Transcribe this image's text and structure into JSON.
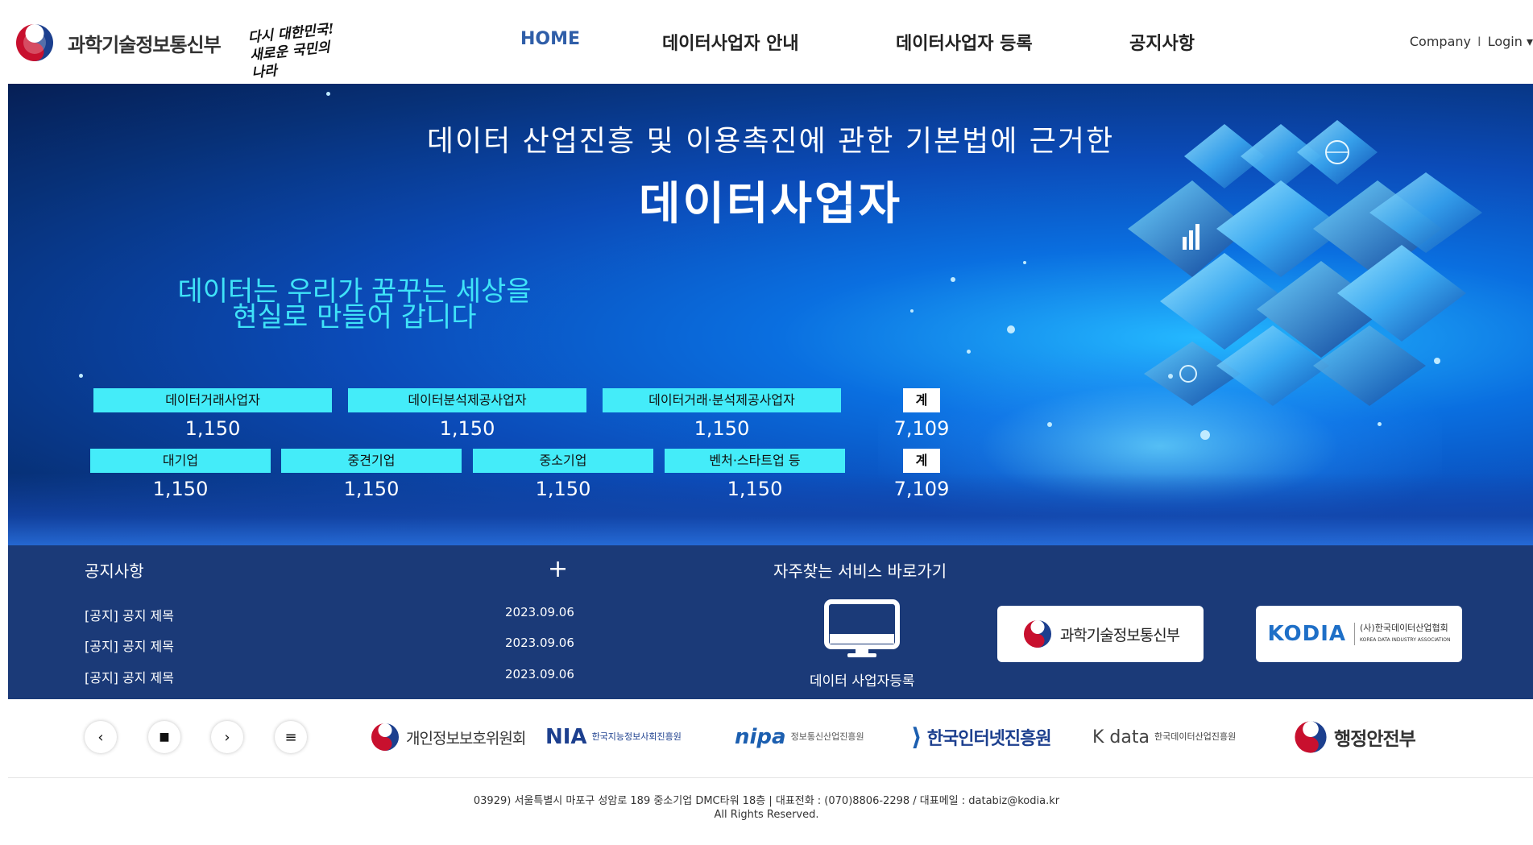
{
  "header": {
    "ministry_name": "과학기술정보통신부",
    "slogan": "다시 대한민국! 새로운 국민의 나라",
    "nav": [
      {
        "label": "HOME",
        "active": true
      },
      {
        "label": "데이터사업자 안내",
        "active": false
      },
      {
        "label": "데이터사업자 등록",
        "active": false
      },
      {
        "label": "공지사항",
        "active": false
      }
    ],
    "util": {
      "company": "Company",
      "separator": "I",
      "login": "Login"
    }
  },
  "hero": {
    "subtitle": "데이터 산업진흥 및 이용촉진에 관한 기본법에 근거한",
    "title": "데이터사업자",
    "tagline_line1": "데이터는 우리가 꿈꾸는 세상을",
    "tagline_line2": "현실로 만들어 갑니다",
    "stats_row1": [
      {
        "label": "데이터거래사업자",
        "value": "1,150"
      },
      {
        "label": "데이터분석제공사업자",
        "value": "1,150"
      },
      {
        "label": "데이터거래·분석제공사업자",
        "value": "1,150"
      }
    ],
    "total_row1": {
      "label": "계",
      "value": "7,109"
    },
    "stats_row2": [
      {
        "label": "대기업",
        "value": "1,150"
      },
      {
        "label": "중견기업",
        "value": "1,150"
      },
      {
        "label": "중소기업",
        "value": "1,150"
      },
      {
        "label": "벤처·스타트업 등",
        "value": "1,150"
      }
    ],
    "total_row2": {
      "label": "계",
      "value": "7,109"
    }
  },
  "notice": {
    "title": "공지사항",
    "more": "+",
    "items": [
      {
        "title": "[공지] 공지 제목",
        "date": "2023.09.06"
      },
      {
        "title": "[공지] 공지 제목",
        "date": "2023.09.06"
      },
      {
        "title": "[공지] 공지 제목",
        "date": "2023.09.06"
      }
    ]
  },
  "quick": {
    "title": "자주찾는 서비스 바로가기",
    "register_label": "데이터 사업자등록",
    "card1": "과학기술정보통신부",
    "card2_word": "KODIA",
    "card2_sub_ko": "(사)한국데이터산업협회",
    "card2_sub_en": "KOREA DATA INDUSTRY ASSOCIATION"
  },
  "logos": {
    "controls": [
      "‹",
      "■",
      "›",
      "≡"
    ],
    "pipc": "개인정보보호위원회",
    "nia_word": "NIA",
    "nia_sub": "한국지능정보사회진흥원",
    "nipa_word": "nipa",
    "nipa_sub": "정보통신산업진흥원",
    "kisa": "한국인터넷진흥원",
    "kdata_word": "K data",
    "kdata_sub": "한국데이터산업진흥원",
    "mois": "행정안전부"
  },
  "footer": {
    "address": "03929) 서울특별시 마포구 성암로 189 중소기업 DMC타워 18층 | 대표전화 : (070)8806-2298 / 대표메일 : databiz@kodia.kr",
    "rights": "All Rights Reserved."
  },
  "colors": {
    "accent_cyan": "#44ecf9",
    "nav_active": "#2f5ea8",
    "band": "#1b3a78",
    "hero_blue": "#0b4bb8"
  }
}
